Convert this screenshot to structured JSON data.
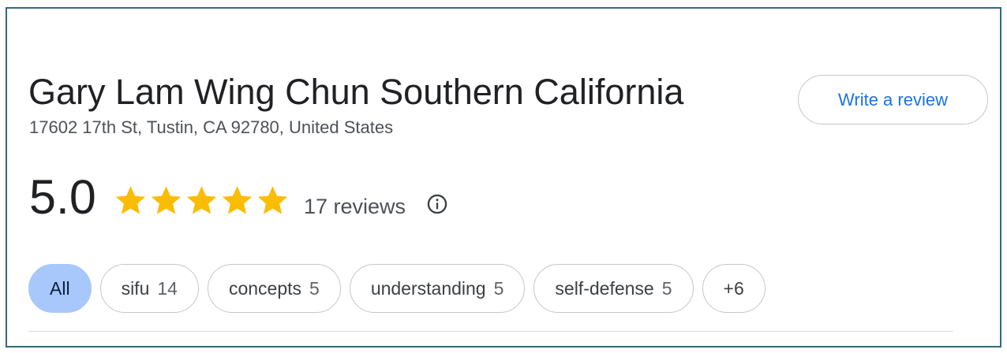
{
  "place": {
    "name": "Gary Lam Wing Chun Southern California",
    "address": "17602 17th St, Tustin, CA 92780, United States"
  },
  "actions": {
    "write_review_label": "Write a review"
  },
  "rating": {
    "value": "5.0",
    "stars_filled": 5,
    "stars_total": 5,
    "reviews_label": "17 reviews",
    "star_color": "#fbbc04"
  },
  "filters": [
    {
      "label": "All",
      "count": "",
      "selected": true
    },
    {
      "label": "sifu",
      "count": "14",
      "selected": false
    },
    {
      "label": "concepts",
      "count": "5",
      "selected": false
    },
    {
      "label": "understanding",
      "count": "5",
      "selected": false
    },
    {
      "label": "self-defense",
      "count": "5",
      "selected": false
    },
    {
      "label": "+6",
      "count": "",
      "selected": false
    }
  ],
  "colors": {
    "accent": "#1a73e8",
    "selected_chip": "#a8c7fa",
    "frame_border": "#2f6b7a"
  },
  "icons": {
    "info": "info-icon",
    "star": "star-icon"
  }
}
